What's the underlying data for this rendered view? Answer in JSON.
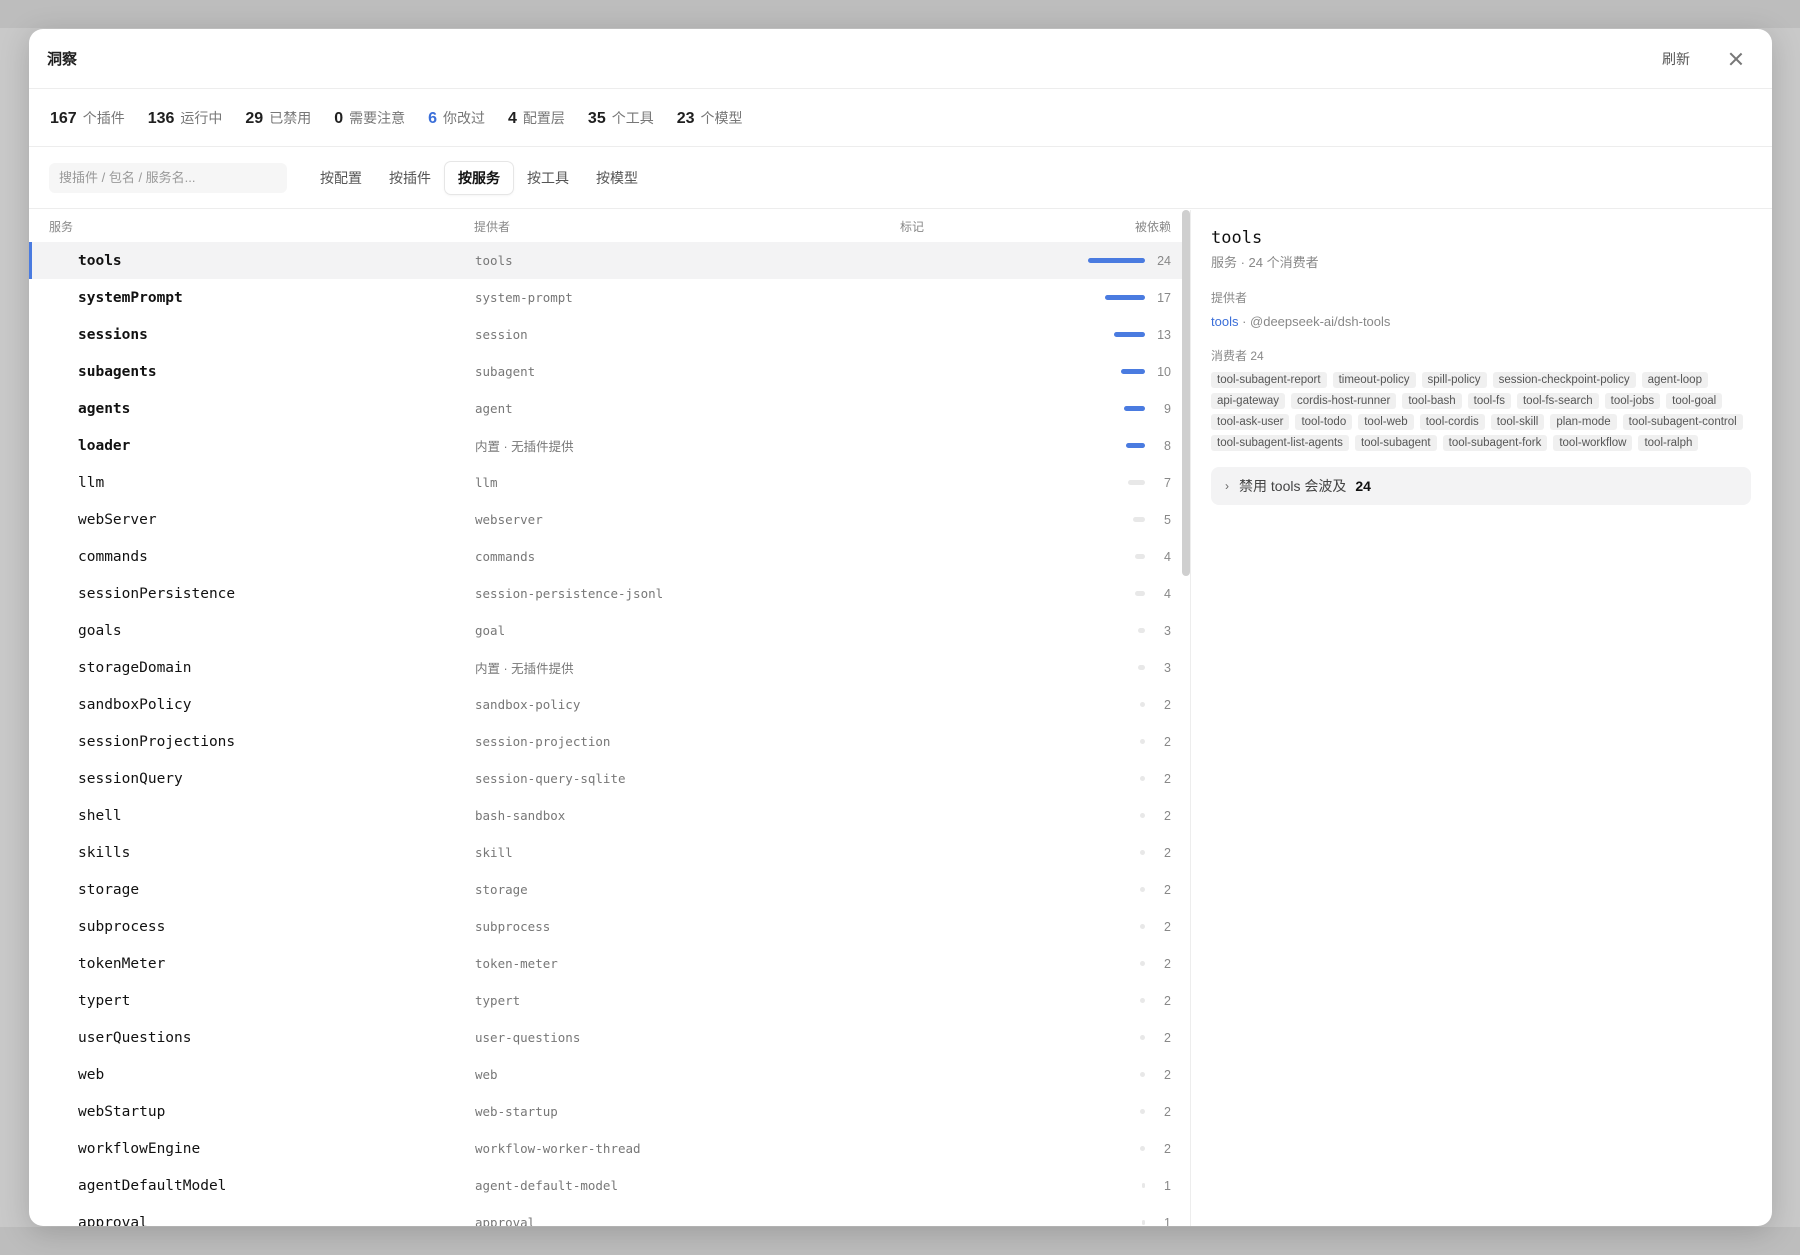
{
  "window": {
    "title": "洞察",
    "refresh_label": "刷新"
  },
  "stats": [
    {
      "num": "167",
      "label": "个插件"
    },
    {
      "num": "136",
      "label": "运行中"
    },
    {
      "num": "29",
      "label": "已禁用"
    },
    {
      "num": "0",
      "label": "需要注意"
    },
    {
      "num": "6",
      "label": "你改过"
    },
    {
      "num": "4",
      "label": "配置层"
    },
    {
      "num": "35",
      "label": "个工具"
    },
    {
      "num": "23",
      "label": "个模型"
    }
  ],
  "search": {
    "placeholder": "搜插件 / 包名 / 服务名...",
    "value": ""
  },
  "tabs": [
    "按配置",
    "按插件",
    "按服务",
    "按工具",
    "按模型"
  ],
  "active_tab": "按服务",
  "columns": {
    "service": "服务",
    "provider": "提供者",
    "mark": "标记",
    "depended": "被依赖"
  },
  "rows": [
    {
      "service": "tools",
      "provider": "tools",
      "count": "24",
      "bold": true,
      "selected": true
    },
    {
      "service": "systemPrompt",
      "provider": "system-prompt",
      "count": "17",
      "bold": true
    },
    {
      "service": "sessions",
      "provider": "session",
      "count": "13",
      "bold": true
    },
    {
      "service": "subagents",
      "provider": "subagent",
      "count": "10",
      "bold": true
    },
    {
      "service": "agents",
      "provider": "agent",
      "count": "9",
      "bold": true
    },
    {
      "service": "loader",
      "provider": "内置 · 无插件提供",
      "count": "8",
      "bold": true,
      "builtin": true
    },
    {
      "service": "llm",
      "provider": "llm",
      "count": "7"
    },
    {
      "service": "webServer",
      "provider": "webserver",
      "count": "5"
    },
    {
      "service": "commands",
      "provider": "commands",
      "count": "4"
    },
    {
      "service": "sessionPersistence",
      "provider": "session-persistence-jsonl",
      "count": "4"
    },
    {
      "service": "goals",
      "provider": "goal",
      "count": "3"
    },
    {
      "service": "storageDomain",
      "provider": "内置 · 无插件提供",
      "count": "3",
      "builtin": true
    },
    {
      "service": "sandboxPolicy",
      "provider": "sandbox-policy",
      "count": "2"
    },
    {
      "service": "sessionProjections",
      "provider": "session-projection",
      "count": "2"
    },
    {
      "service": "sessionQuery",
      "provider": "session-query-sqlite",
      "count": "2"
    },
    {
      "service": "shell",
      "provider": "bash-sandbox",
      "count": "2"
    },
    {
      "service": "skills",
      "provider": "skill",
      "count": "2"
    },
    {
      "service": "storage",
      "provider": "storage",
      "count": "2"
    },
    {
      "service": "subprocess",
      "provider": "subprocess",
      "count": "2"
    },
    {
      "service": "tokenMeter",
      "provider": "token-meter",
      "count": "2"
    },
    {
      "service": "typert",
      "provider": "typert",
      "count": "2"
    },
    {
      "service": "userQuestions",
      "provider": "user-questions",
      "count": "2"
    },
    {
      "service": "web",
      "provider": "web",
      "count": "2"
    },
    {
      "service": "webStartup",
      "provider": "web-startup",
      "count": "2"
    },
    {
      "service": "workflowEngine",
      "provider": "workflow-worker-thread",
      "count": "2"
    },
    {
      "service": "agentDefaultModel",
      "provider": "agent-default-model",
      "count": "1"
    },
    {
      "service": "approval",
      "provider": "approval",
      "count": "1"
    }
  ],
  "detail": {
    "title": "tools",
    "subtitle": "服务 · 24 个消费者",
    "provider_label": "提供者",
    "provider_link": "tools",
    "provider_pkg": " · @deepseek-ai/dsh-tools",
    "consumers_label": "消费者  24",
    "consumers": [
      "tool-subagent-report",
      "timeout-policy",
      "spill-policy",
      "session-checkpoint-policy",
      "agent-loop",
      "api-gateway",
      "cordis-host-runner",
      "tool-bash",
      "tool-fs",
      "tool-fs-search",
      "tool-jobs",
      "tool-goal",
      "tool-ask-user",
      "tool-todo",
      "tool-web",
      "tool-cordis",
      "tool-skill",
      "plan-mode",
      "tool-subagent-control",
      "tool-subagent-list-agents",
      "tool-subagent",
      "tool-subagent-fork",
      "tool-workflow",
      "tool-ralph"
    ],
    "impact_prefix": "禁用 tools 会波及",
    "impact_count": "24"
  },
  "colors": {
    "accent": "#4a7be0",
    "link": "#3b6fd9"
  }
}
